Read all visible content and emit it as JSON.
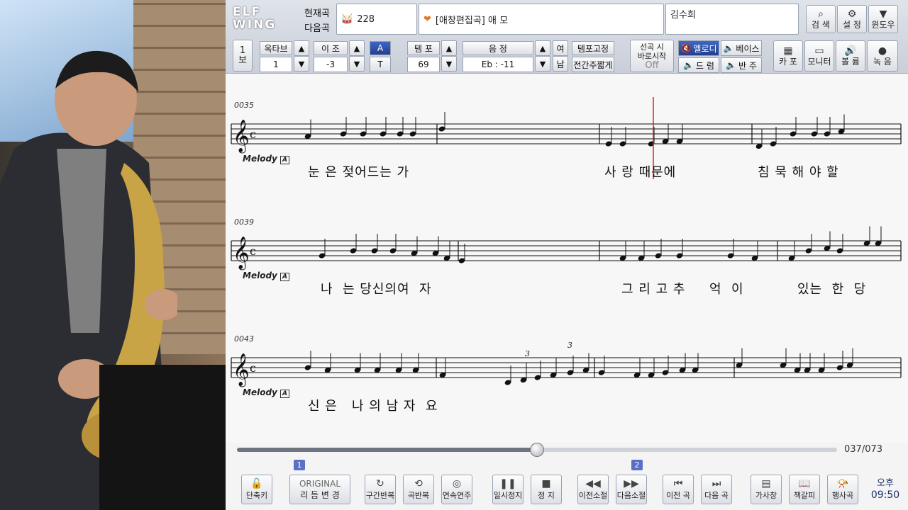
{
  "app": {
    "labels": {
      "current": "현재곡",
      "next": "다음곡"
    },
    "song_number": "228",
    "song_title": "[애창편집곡] 애 모",
    "singer": "김수희"
  },
  "top_buttons": [
    {
      "name": "search-button",
      "label": "검 색",
      "icon": "search-icon"
    },
    {
      "name": "settings-button",
      "label": "설 정",
      "icon": "gear-icon"
    },
    {
      "name": "window-button",
      "label": "윈도우",
      "icon": "chevron-down-icon"
    }
  ],
  "controls": {
    "page": {
      "top": "1",
      "bottom": "보"
    },
    "octave": {
      "label": "옥타브",
      "value": "1"
    },
    "transpose": {
      "label": "이 조",
      "value": "-3"
    },
    "at": {
      "a": "A",
      "t": "T"
    },
    "tempo": {
      "label": "템 포",
      "value": "69"
    },
    "key": {
      "label": "음 정",
      "value": "Eb : -11"
    },
    "gender": {
      "female": "여",
      "male": "남"
    },
    "tempo_fixed": "템포고정",
    "interlude": "전간주짧게",
    "select_start": {
      "line1": "선곡 시",
      "line2": "바로시작",
      "state": "Off"
    },
    "melody": "멜로디",
    "bass": "베이스",
    "drum": "드 럼",
    "accomp": "반 주"
  },
  "right_buttons": [
    {
      "name": "capo-button",
      "label": "카 포",
      "icon": "capo-icon"
    },
    {
      "name": "monitor-button",
      "label": "모니터",
      "icon": "monitor-icon"
    },
    {
      "name": "volume-button",
      "label": "볼 륨",
      "icon": "speaker-icon"
    },
    {
      "name": "record-button",
      "label": "녹 음",
      "icon": "record-icon"
    }
  ],
  "score": {
    "systems": [
      {
        "measure": "0035",
        "melody": "Melody",
        "lyrics": [
          {
            "text": "눈 은 젖어드는 가"
          },
          {
            "text": "사 랑 때문에"
          },
          {
            "text": "침 묵 해 야 할"
          }
        ]
      },
      {
        "measure": "0039",
        "melody": "Melody",
        "lyrics": [
          {
            "text": "나  는 당신의여  자"
          },
          {
            "text": "그 리 고 추     억  이"
          },
          {
            "text": "있는  한  당"
          }
        ]
      },
      {
        "measure": "0043",
        "melody": "Melody",
        "lyrics": [
          {
            "text": "신 은   나 의 남 자  요"
          }
        ]
      }
    ],
    "triplet": "3"
  },
  "playback": {
    "position": "037/073",
    "progress": 0.5
  },
  "bottom_buttons": [
    {
      "name": "shortcut-button",
      "label": "단축키",
      "icon": "unlock-icon"
    },
    {
      "name": "rhythm-change-button",
      "label": "리 듬 변 경",
      "top": "ORIGINAL"
    },
    {
      "name": "section-repeat-button",
      "label": "구간반복",
      "icon": "repeat-a-icon"
    },
    {
      "name": "song-repeat-button",
      "label": "곡반복",
      "icon": "repeat-icon"
    },
    {
      "name": "continuous-play-button",
      "label": "연속연주",
      "icon": "continuous-icon"
    },
    {
      "name": "pause-button",
      "label": "일시정지",
      "icon": "pause-icon"
    },
    {
      "name": "stop-button",
      "label": "정 지",
      "icon": "stop-icon"
    },
    {
      "name": "prev-measure-button",
      "label": "이전소절",
      "icon": "rewind-icon"
    },
    {
      "name": "next-measure-button",
      "label": "다음소절",
      "icon": "fast-forward-icon"
    },
    {
      "name": "prev-song-button",
      "label": "이전 곡",
      "icon": "skip-back-icon"
    },
    {
      "name": "next-song-button",
      "label": "다음 곡",
      "icon": "skip-forward-icon"
    },
    {
      "name": "lyrics-window-button",
      "label": "가사창",
      "icon": "lyrics-icon"
    },
    {
      "name": "bookmark-button",
      "label": "책갈피",
      "icon": "book-icon"
    },
    {
      "name": "event-song-button",
      "label": "행사곡",
      "icon": "horn-icon"
    }
  ],
  "badges": [
    "1",
    "2"
  ],
  "clock": {
    "ampm": "오후",
    "time": "09:50"
  }
}
